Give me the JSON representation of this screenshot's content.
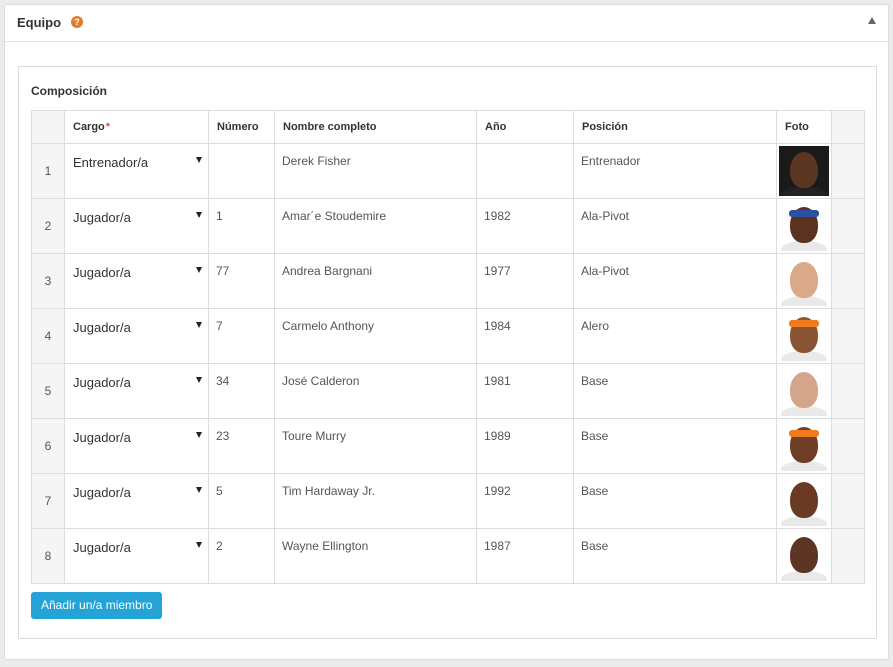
{
  "panel": {
    "title": "Equipo",
    "help_icon": "?"
  },
  "fieldset": {
    "title": "Composición"
  },
  "table": {
    "headers": {
      "cargo": "Cargo",
      "required_mark": "*",
      "numero": "Número",
      "nombre": "Nombre completo",
      "anio": "Año",
      "posicion": "Posición",
      "foto": "Foto"
    },
    "rows": [
      {
        "n": "1",
        "cargo": "Entrenador/a",
        "numero": "",
        "nombre": "Derek Fisher",
        "anio": "",
        "posicion": "Entrenador",
        "photo": {
          "skin": "#5a3522",
          "bg": "#1a1a1a",
          "band": "",
          "shirt": "#222222"
        }
      },
      {
        "n": "2",
        "cargo": "Jugador/a",
        "numero": "1",
        "nombre": "Amar´e Stoudemire",
        "anio": "1982",
        "posicion": "Ala-Pivot",
        "photo": {
          "skin": "#5b3220",
          "bg": "#ffffff",
          "band": "#2c4f9e",
          "shirt": "#ffffff"
        }
      },
      {
        "n": "3",
        "cargo": "Jugador/a",
        "numero": "77",
        "nombre": "Andrea Bargnani",
        "anio": "1977",
        "posicion": "Ala-Pivot",
        "photo": {
          "skin": "#d9a98a",
          "bg": "#ffffff",
          "band": "",
          "shirt": "#ffffff"
        }
      },
      {
        "n": "4",
        "cargo": "Jugador/a",
        "numero": "7",
        "nombre": "Carmelo Anthony",
        "anio": "1984",
        "posicion": "Alero",
        "photo": {
          "skin": "#8a5535",
          "bg": "#ffffff",
          "band": "#f07a1c",
          "shirt": "#ffffff"
        }
      },
      {
        "n": "5",
        "cargo": "Jugador/a",
        "numero": "34",
        "nombre": "José Calderon",
        "anio": "1981",
        "posicion": "Base",
        "photo": {
          "skin": "#d3a58a",
          "bg": "#ffffff",
          "band": "",
          "shirt": "#ffffff"
        }
      },
      {
        "n": "6",
        "cargo": "Jugador/a",
        "numero": "23",
        "nombre": "Toure Murry",
        "anio": "1989",
        "posicion": "Base",
        "photo": {
          "skin": "#6e3f26",
          "bg": "#ffffff",
          "band": "#f07a1c",
          "shirt": "#ffffff"
        }
      },
      {
        "n": "7",
        "cargo": "Jugador/a",
        "numero": "5",
        "nombre": "Tim Hardaway Jr.",
        "anio": "1992",
        "posicion": "Base",
        "photo": {
          "skin": "#6b3a22",
          "bg": "#ffffff",
          "band": "",
          "shirt": "#ffffff"
        }
      },
      {
        "n": "8",
        "cargo": "Jugador/a",
        "numero": "2",
        "nombre": "Wayne Ellington",
        "anio": "1987",
        "posicion": "Base",
        "photo": {
          "skin": "#5e3522",
          "bg": "#ffffff",
          "band": "",
          "shirt": "#ffffff"
        }
      }
    ]
  },
  "add_button": {
    "label": "Añadir un/a miembro"
  },
  "colors": {
    "accent": "#23a3d6",
    "help": "#e37b29",
    "required": "#d9534f"
  },
  "icons": {
    "help": "question-circle-icon",
    "collapse": "chevron-up-icon",
    "dropdown": "caret-down-icon"
  }
}
